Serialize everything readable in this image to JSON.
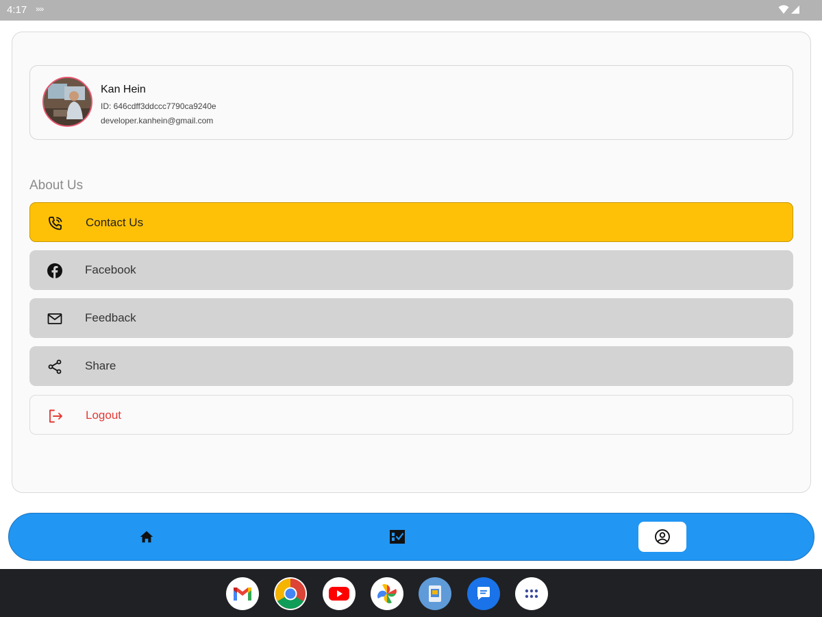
{
  "status_bar": {
    "time": "4:17",
    "extra_glyph": "»»"
  },
  "profile": {
    "name": "Kan Hein",
    "id_text": "ID: 646cdff3ddccc7790ca9240e",
    "email": "developer.kanhein@gmail.com"
  },
  "about": {
    "title": "About Us",
    "items": [
      {
        "label": "Contact Us",
        "icon": "phone-call-icon"
      },
      {
        "label": "Facebook",
        "icon": "facebook-icon"
      },
      {
        "label": "Feedback",
        "icon": "mail-icon"
      },
      {
        "label": "Share",
        "icon": "share-icon"
      },
      {
        "label": "Logout",
        "icon": "logout-icon"
      }
    ]
  },
  "bottom_nav": {
    "items": [
      "home-icon",
      "task-check-icon",
      "account-circle-icon"
    ],
    "selected": "account-circle-icon"
  },
  "dock": {
    "apps": [
      "gmail-icon",
      "chrome-icon",
      "youtube-icon",
      "photos-icon",
      "files-icon",
      "messages-icon",
      "app-drawer-icon"
    ]
  },
  "colors": {
    "accent_yellow": "#ffc107",
    "nav_blue": "#2196f3",
    "menu_grey": "#d3d3d3",
    "logout_red": "#e53935",
    "dock_dark": "#202124"
  }
}
